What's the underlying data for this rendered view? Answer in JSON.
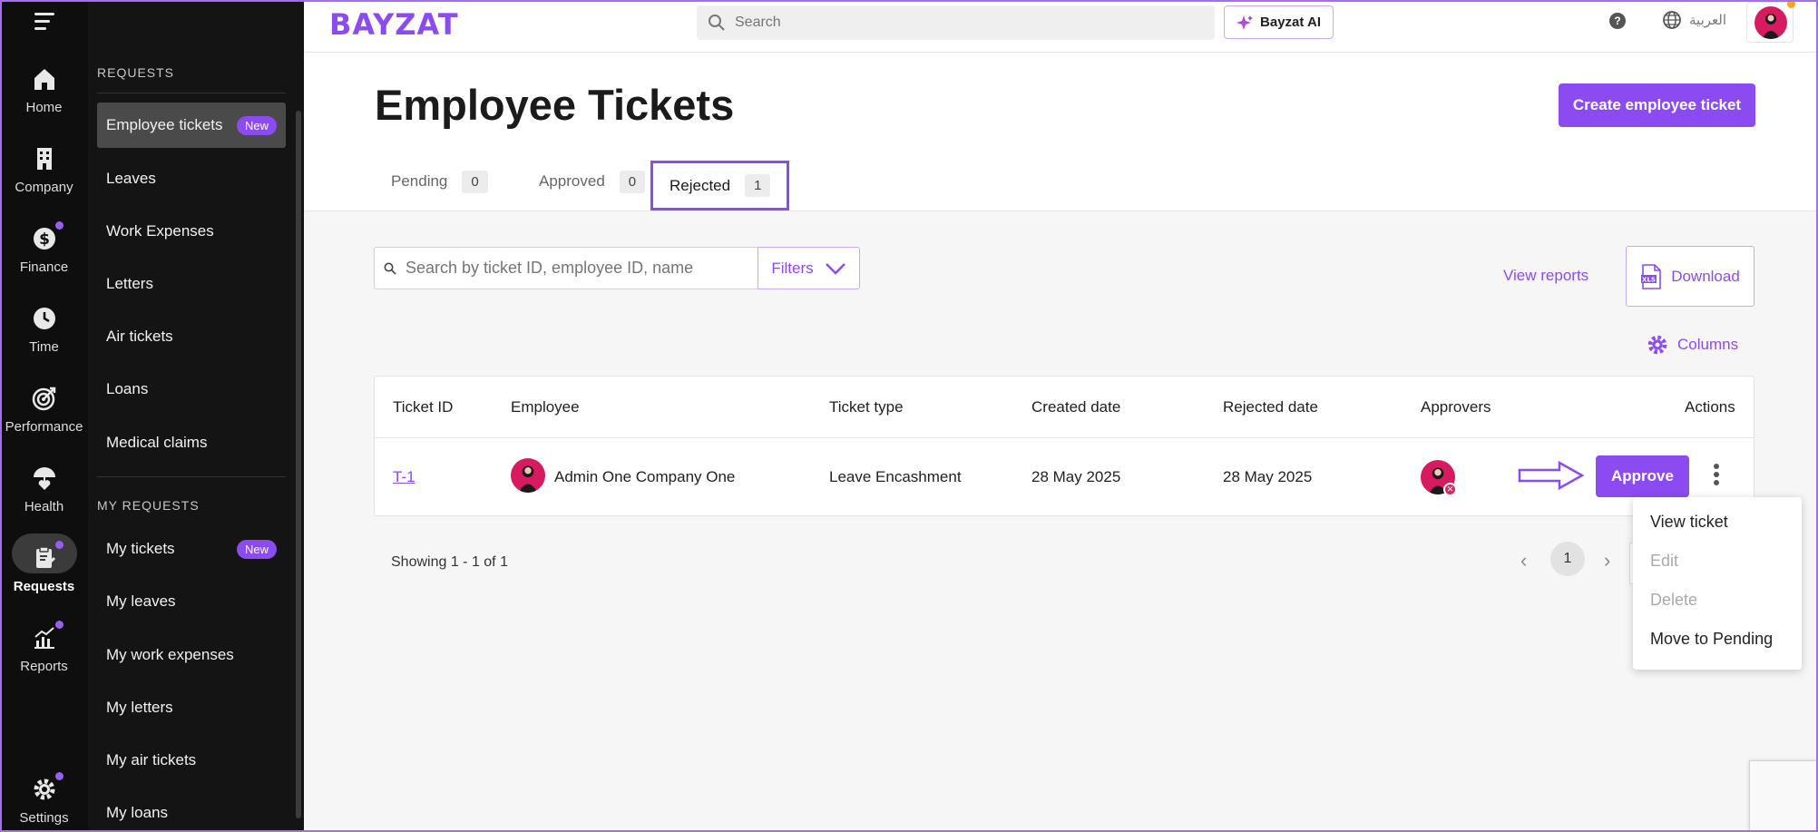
{
  "rail": {
    "items": [
      {
        "label": "Home",
        "icon": "home-icon",
        "dot": false
      },
      {
        "label": "Company",
        "icon": "building-icon",
        "dot": false
      },
      {
        "label": "Finance",
        "icon": "dollar-icon",
        "dot": true
      },
      {
        "label": "Time",
        "icon": "clock-icon",
        "dot": false
      },
      {
        "label": "Performance",
        "icon": "target-icon",
        "dot": false
      },
      {
        "label": "Health",
        "icon": "umbrella-heart-icon",
        "dot": false
      },
      {
        "label": "Requests",
        "icon": "clipboard-icon",
        "dot": true,
        "active": true
      },
      {
        "label": "Reports",
        "icon": "chart-icon",
        "dot": true
      },
      {
        "label": "Settings",
        "icon": "gear-icon",
        "dot": true
      }
    ]
  },
  "subnav": {
    "section1": "REQUESTS",
    "items1": [
      "Employee tickets",
      "Leaves",
      "Work Expenses",
      "Letters",
      "Air tickets",
      "Loans",
      "Medical claims"
    ],
    "section2": "MY REQUESTS",
    "items2": [
      "My tickets",
      "My leaves",
      "My work expenses",
      "My letters",
      "My air tickets",
      "My loans"
    ],
    "new_badge": "New"
  },
  "topbar": {
    "logo": "BAYZAT",
    "search_placeholder": "Search",
    "ai_label": "Bayzat AI",
    "help": "?",
    "language": "العربية"
  },
  "header": {
    "title": "Employee Tickets",
    "create_button": "Create employee ticket",
    "tabs": [
      {
        "label": "Pending",
        "count": "0"
      },
      {
        "label": "Approved",
        "count": "0"
      },
      {
        "label": "Rejected",
        "count": "1"
      }
    ]
  },
  "controls": {
    "search_placeholder": "Search by ticket ID, employee ID, name",
    "filters": "Filters",
    "view_reports": "View reports",
    "download": "Download",
    "columns": "Columns"
  },
  "table": {
    "headers": [
      "Ticket ID",
      "Employee",
      "Ticket type",
      "Created date",
      "Rejected date",
      "Approvers",
      "Actions"
    ],
    "rows": [
      {
        "ticket_id": "T-1",
        "employee": "Admin One Company One",
        "ticket_type": "Leave Encashment",
        "created": "28 May 2025",
        "rejected": "28 May 2025",
        "action": "Approve"
      }
    ]
  },
  "pagination": {
    "showing": "Showing 1 - 1 of 1",
    "page": "1"
  },
  "menu": {
    "items": [
      {
        "label": "View ticket",
        "disabled": false
      },
      {
        "label": "Edit",
        "disabled": true
      },
      {
        "label": "Delete",
        "disabled": true
      },
      {
        "label": "Move to Pending",
        "disabled": false
      }
    ]
  },
  "colors": {
    "accent": "#8b4bf0",
    "rail_bg": "#0e0e0e",
    "sidebar_bg": "#141414",
    "avatar": "#d81b60"
  }
}
